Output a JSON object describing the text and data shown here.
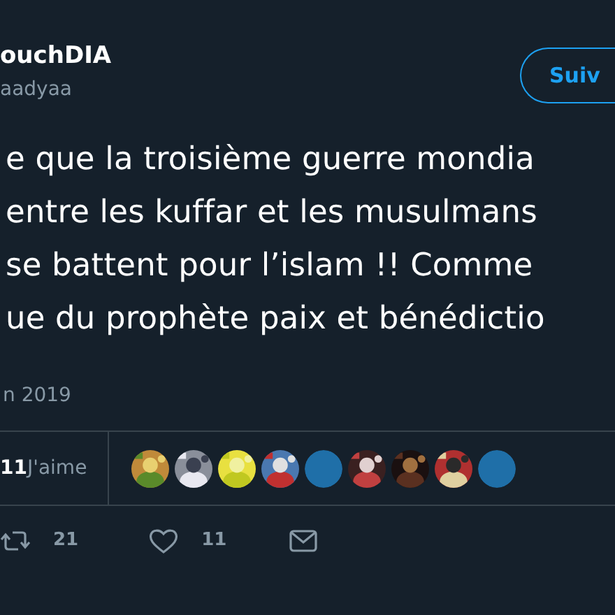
{
  "author": {
    "name": "ouchDIA",
    "handle": "aadyaa"
  },
  "follow_button": "Suiv",
  "tweet_lines": [
    "e que la troisième guerre mondia",
    "entre les kuffar et les musulmans",
    "se battent pour l’islam !! Comme",
    "ue du prophète paix et bénédictio"
  ],
  "date": "n 2019",
  "likes": {
    "count": "11",
    "label": "J'aime"
  },
  "likers": [
    {
      "kind": "picture"
    },
    {
      "kind": "picture"
    },
    {
      "kind": "picture"
    },
    {
      "kind": "picture"
    },
    {
      "kind": "plain"
    },
    {
      "kind": "picture"
    },
    {
      "kind": "picture"
    },
    {
      "kind": "picture"
    },
    {
      "kind": "plain"
    }
  ],
  "actions": [
    {
      "kind": "retweet",
      "count": "21"
    },
    {
      "kind": "like",
      "count": "11"
    },
    {
      "kind": "message"
    }
  ]
}
